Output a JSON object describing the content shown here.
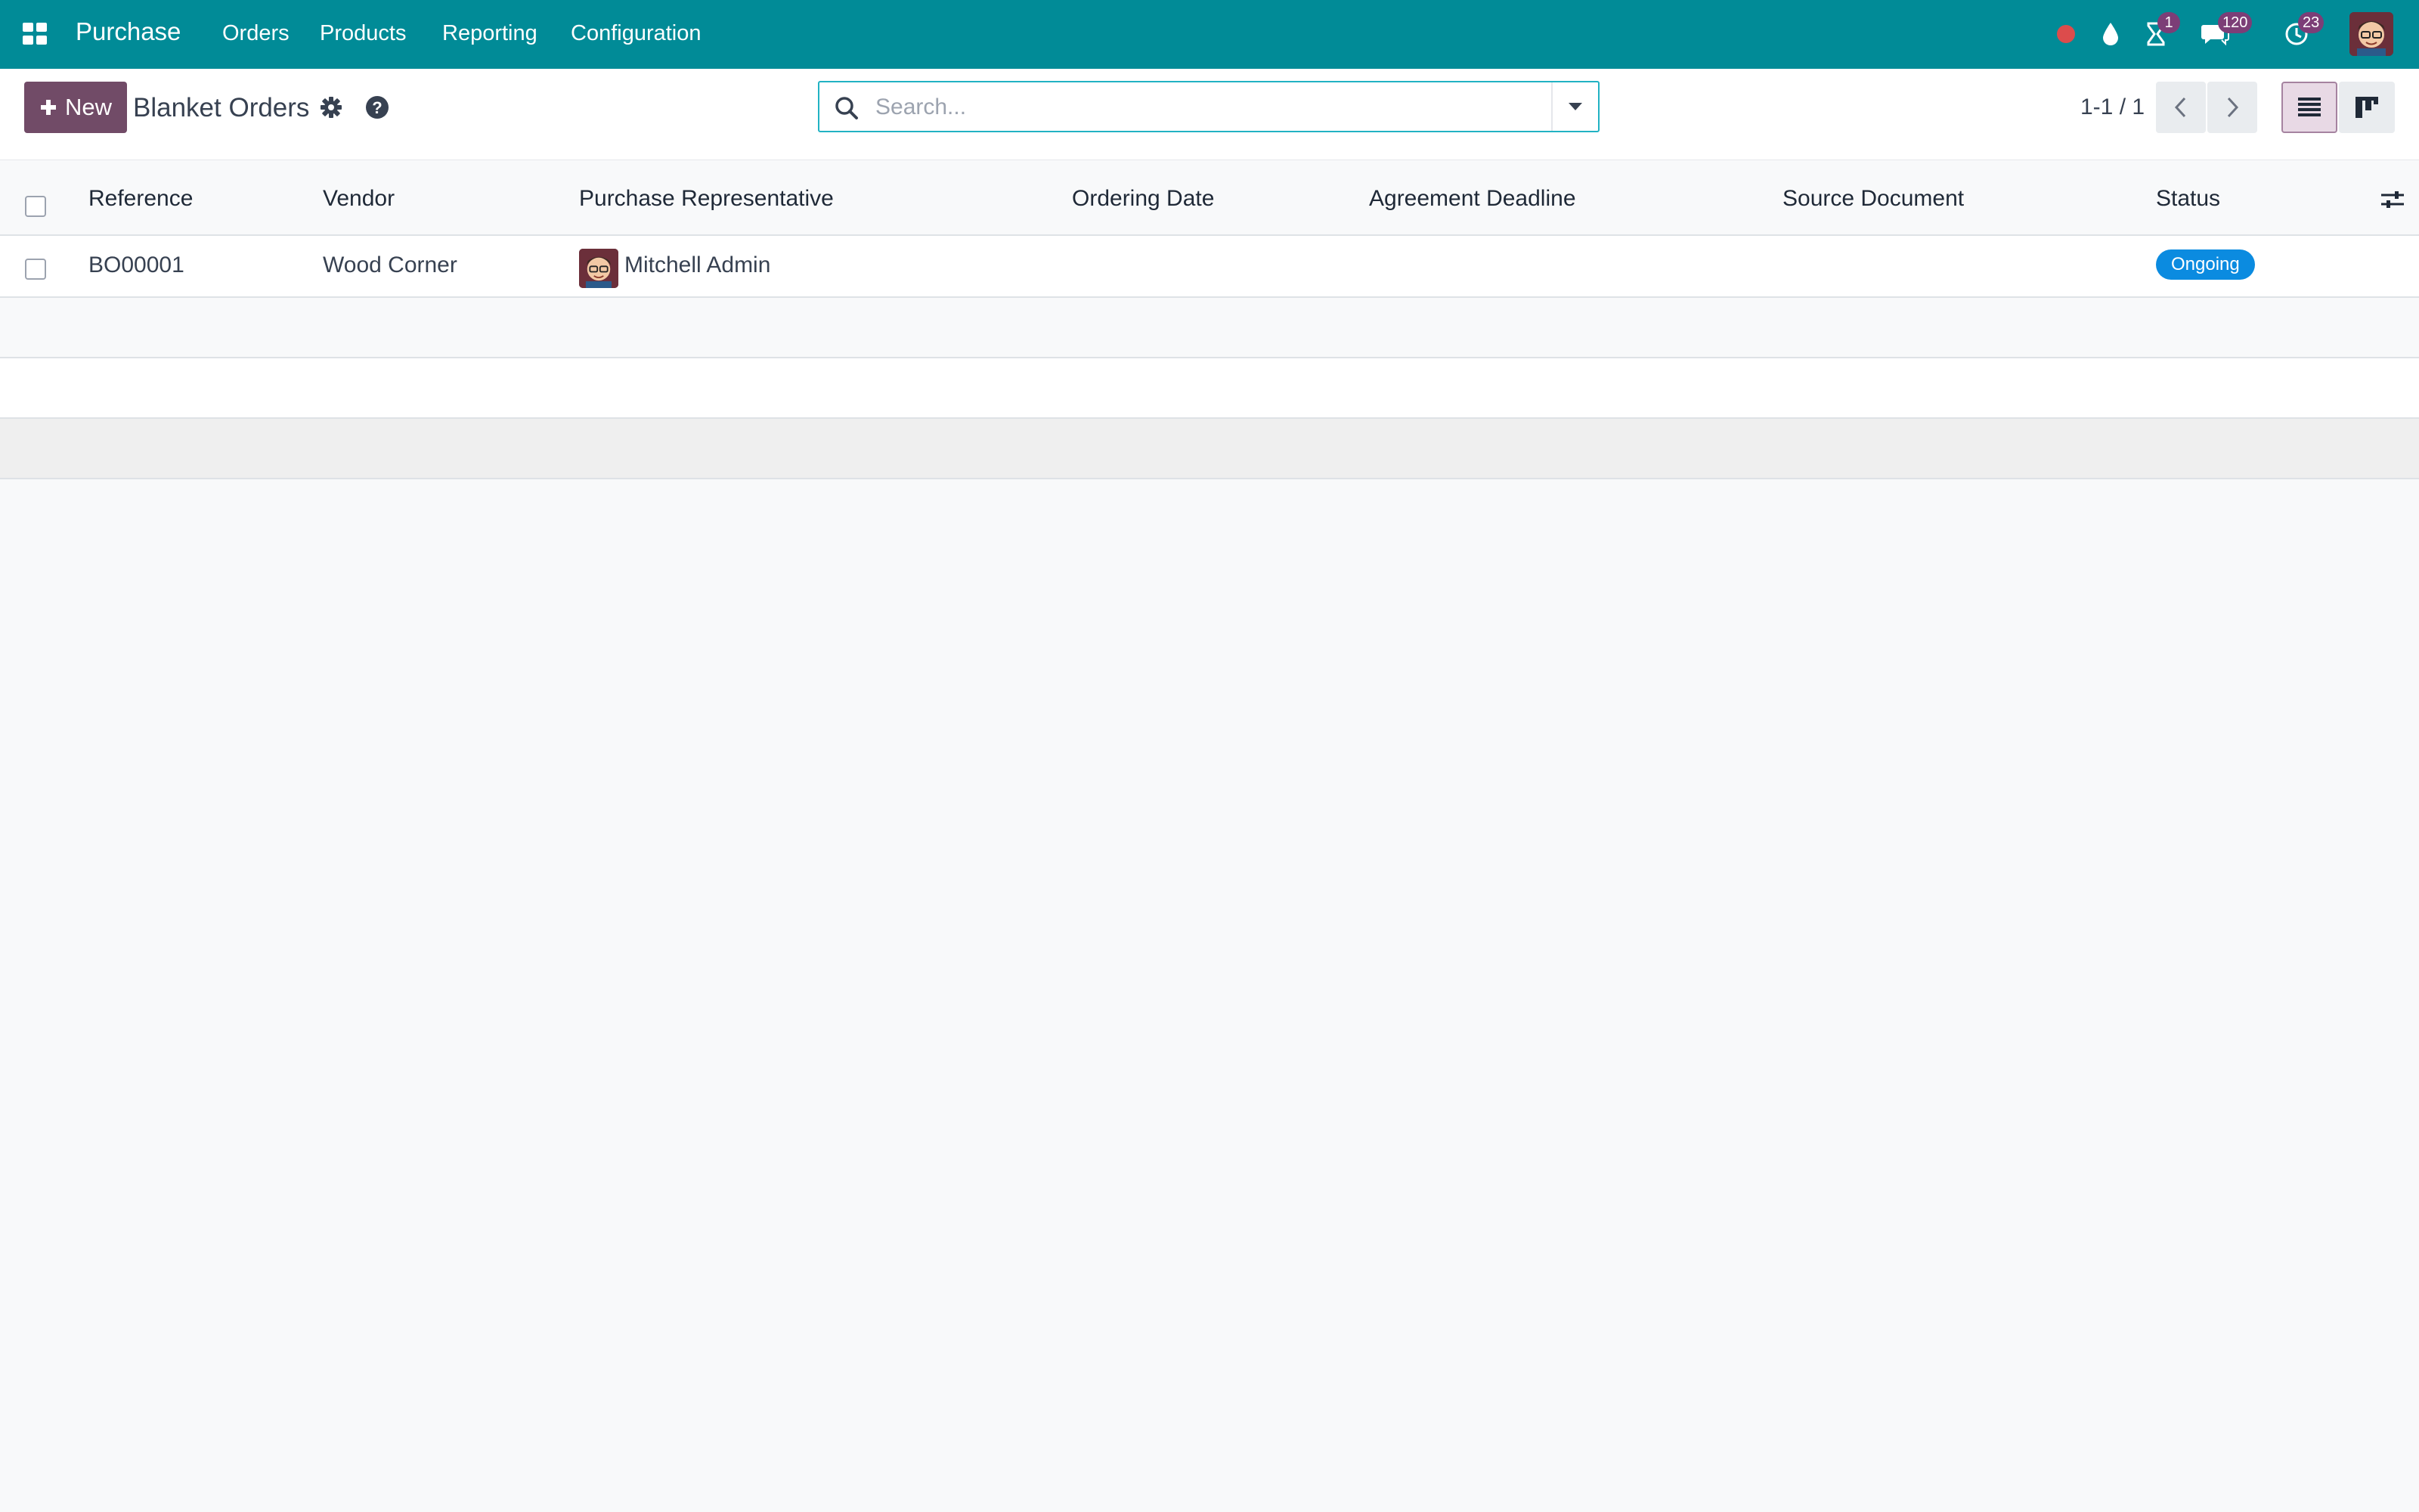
{
  "navbar": {
    "app_name": "Purchase",
    "menu": [
      "Orders",
      "Products",
      "Reporting",
      "Configuration"
    ],
    "activity_badge": "1",
    "messages_badge": "120",
    "clock_badge": "23"
  },
  "control_panel": {
    "new_label": "New",
    "title": "Blanket Orders",
    "search_placeholder": "Search...",
    "pager": "1-1 / 1"
  },
  "table": {
    "columns": [
      "Reference",
      "Vendor",
      "Purchase Representative",
      "Ordering Date",
      "Agreement Deadline",
      "Source Document",
      "Status"
    ],
    "rows": [
      {
        "reference": "BO00001",
        "vendor": "Wood Corner",
        "representative": "Mitchell Admin",
        "ordering_date": "",
        "agreement_deadline": "",
        "source_document": "",
        "status": "Ongoing"
      }
    ]
  },
  "colors": {
    "navbar": "#018b97",
    "primary": "#714b67",
    "status_ongoing": "#0b8be0",
    "badge": "#7c3e77"
  }
}
